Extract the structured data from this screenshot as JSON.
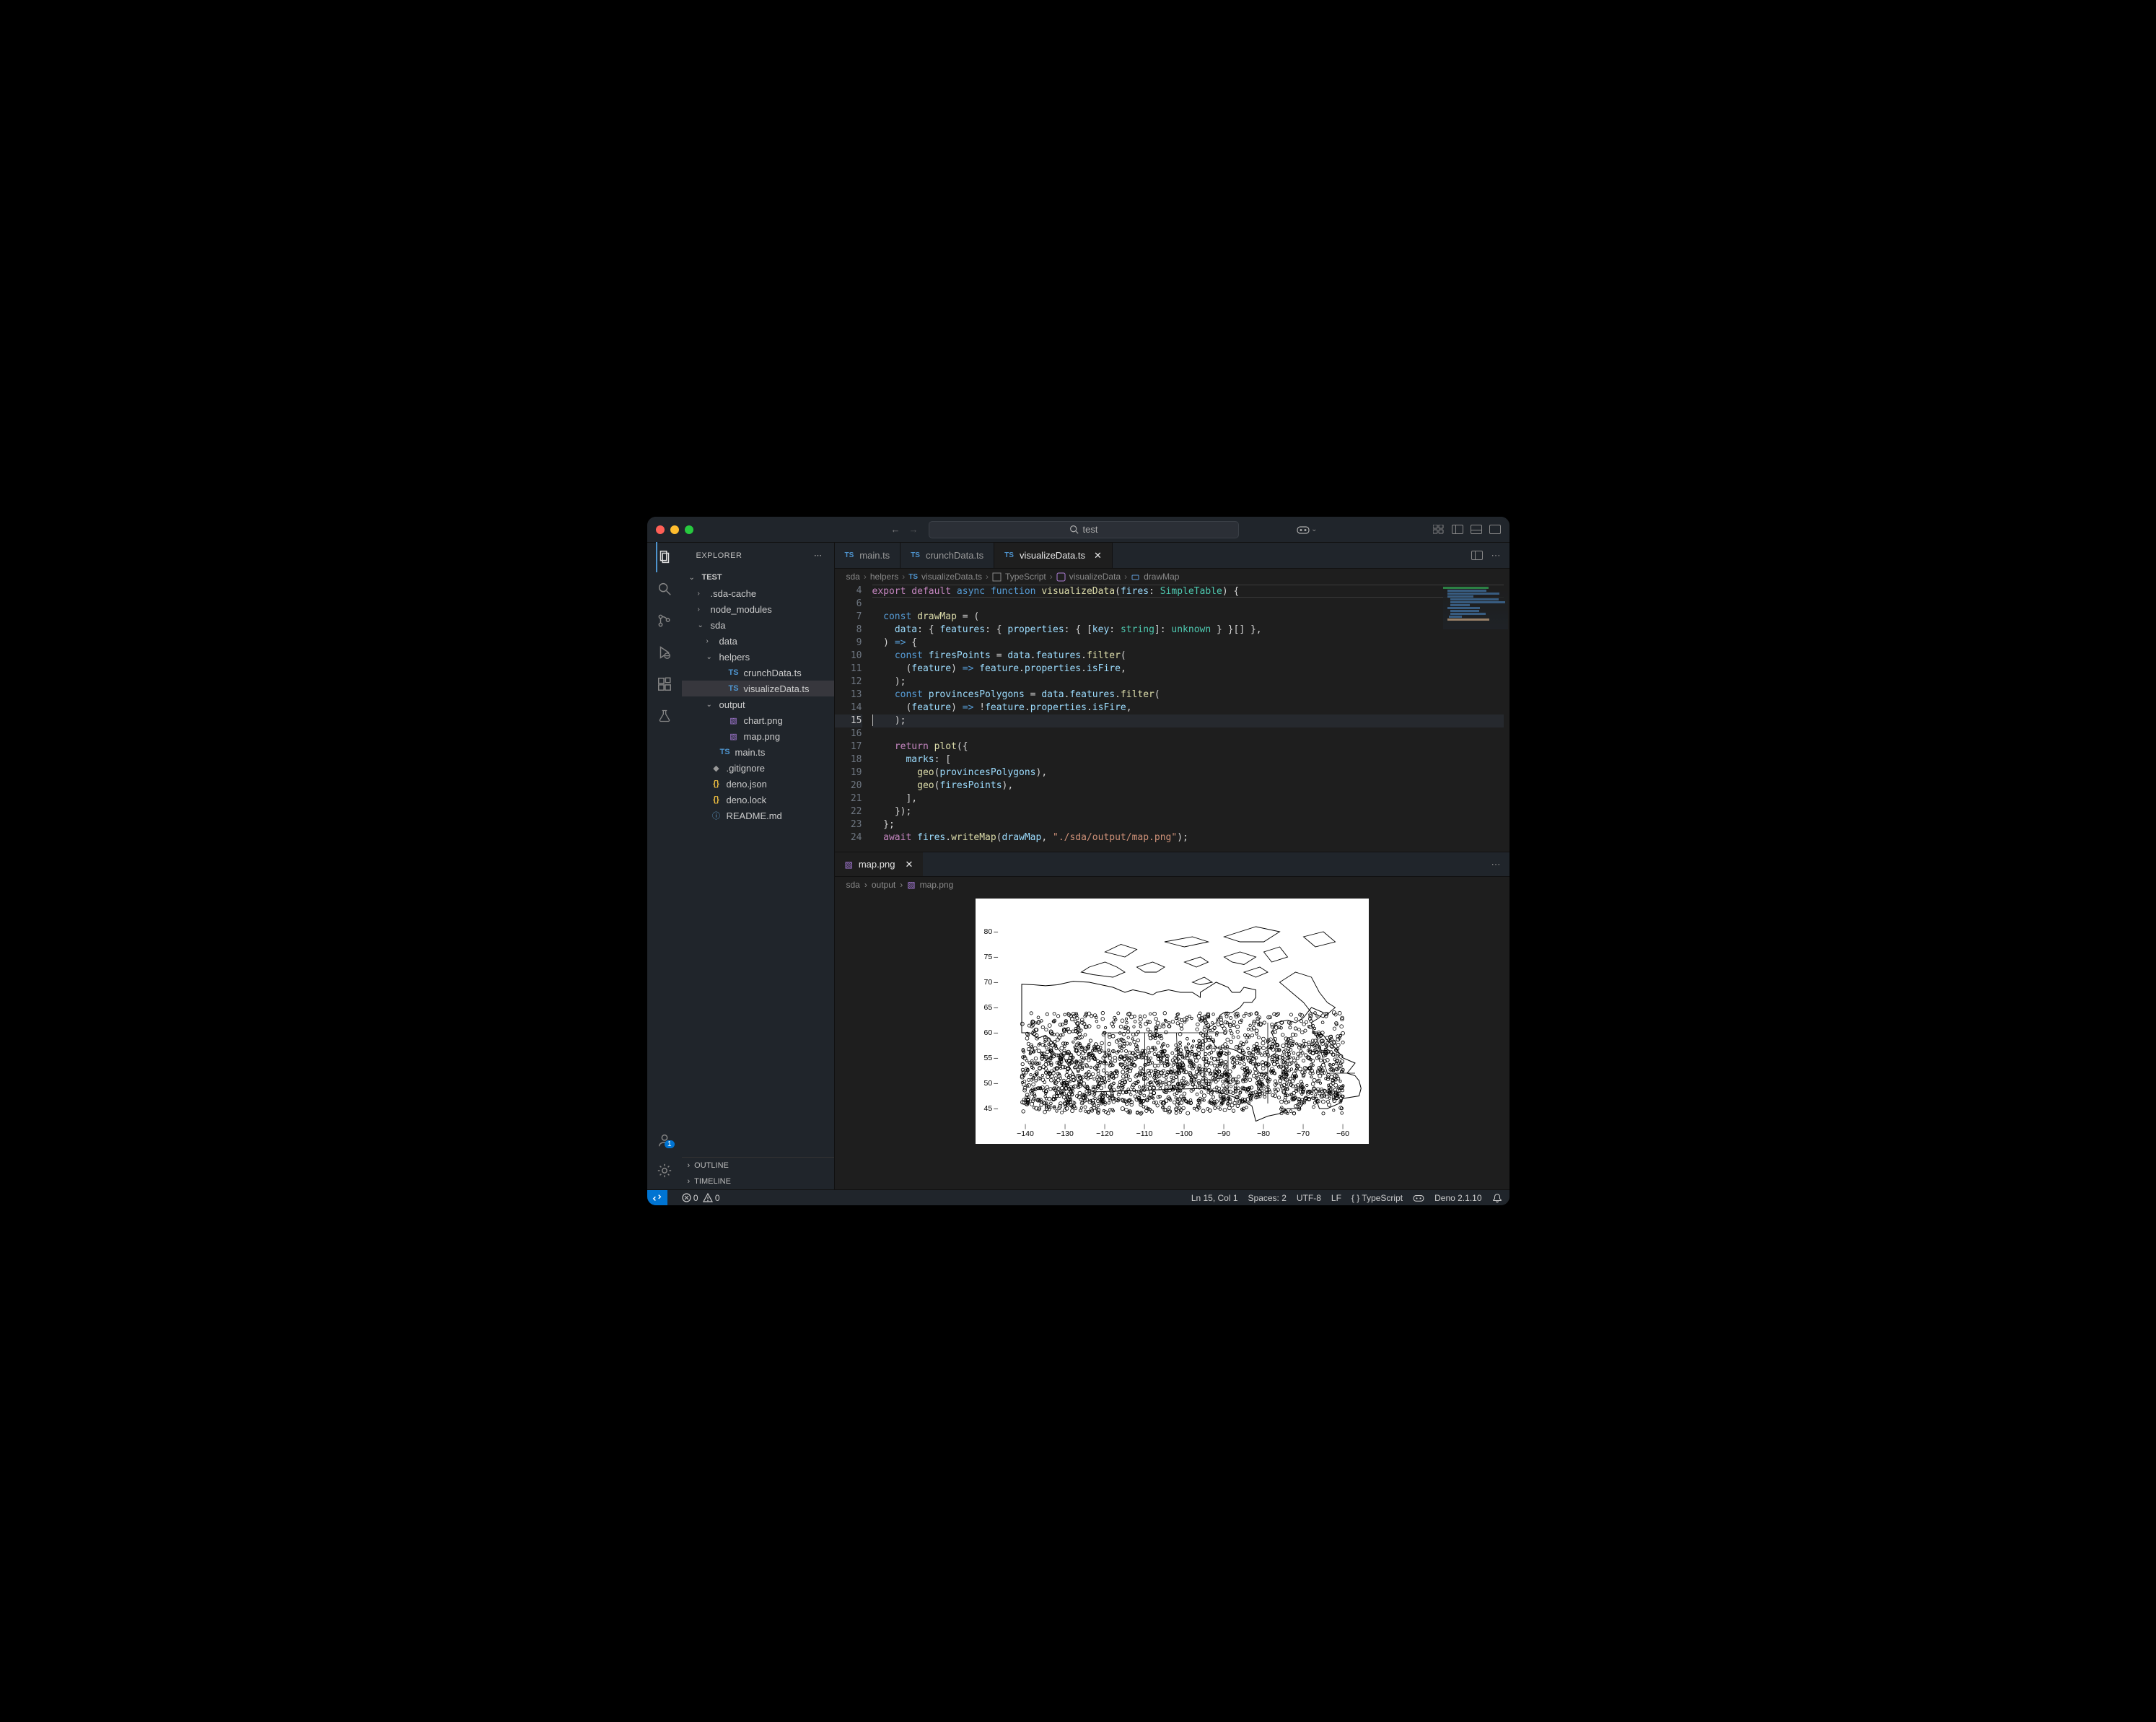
{
  "titlebar": {
    "search_text": "test"
  },
  "sidebar": {
    "title": "EXPLORER",
    "root": "TEST",
    "tree": [
      {
        "kind": "folder",
        "open": false,
        "depth": 1,
        "label": ".sda-cache"
      },
      {
        "kind": "folder",
        "open": false,
        "depth": 1,
        "label": "node_modules"
      },
      {
        "kind": "folder",
        "open": true,
        "depth": 1,
        "label": "sda"
      },
      {
        "kind": "folder",
        "open": false,
        "depth": 2,
        "label": "data"
      },
      {
        "kind": "folder",
        "open": true,
        "depth": 2,
        "label": "helpers"
      },
      {
        "kind": "file",
        "icon": "ts",
        "depth": 3,
        "label": "crunchData.ts"
      },
      {
        "kind": "file",
        "icon": "ts",
        "depth": 3,
        "label": "visualizeData.ts",
        "selected": true
      },
      {
        "kind": "folder",
        "open": true,
        "depth": 2,
        "label": "output"
      },
      {
        "kind": "file",
        "icon": "img",
        "depth": 3,
        "label": "chart.png"
      },
      {
        "kind": "file",
        "icon": "img",
        "depth": 3,
        "label": "map.png"
      },
      {
        "kind": "file",
        "icon": "ts",
        "depth": 2,
        "label": "main.ts"
      },
      {
        "kind": "file",
        "icon": "git",
        "depth": 1,
        "label": ".gitignore"
      },
      {
        "kind": "file",
        "icon": "json",
        "depth": 1,
        "label": "deno.json"
      },
      {
        "kind": "file",
        "icon": "json",
        "depth": 1,
        "label": "deno.lock"
      },
      {
        "kind": "file",
        "icon": "info",
        "depth": 1,
        "label": "README.md"
      }
    ],
    "outline": "OUTLINE",
    "timeline": "TIMELINE"
  },
  "tabs": [
    {
      "icon": "ts",
      "label": "main.ts",
      "active": false,
      "close": false
    },
    {
      "icon": "ts",
      "label": "crunchData.ts",
      "active": false,
      "close": false
    },
    {
      "icon": "ts",
      "label": "visualizeData.ts",
      "active": true,
      "close": true
    }
  ],
  "breadcrumb": {
    "parts": [
      "sda",
      "helpers"
    ],
    "file_icon": "ts",
    "file": "visualizeData.ts",
    "lang": "TypeScript",
    "symbol_icon": "fn",
    "symbol": "visualizeData",
    "subsymbol_icon": "var",
    "subsymbol": "drawMap"
  },
  "editor": {
    "start_line": 4,
    "current_line": 15
  },
  "panel": {
    "tab_label": "map.png",
    "breadcrumb": [
      "sda",
      "output"
    ],
    "file": "map.png"
  },
  "statusbar": {
    "errors": "0",
    "warnings": "0",
    "cursor": "Ln 15, Col 1",
    "spaces": "Spaces: 2",
    "encoding": "UTF-8",
    "eol": "LF",
    "lang": "TypeScript",
    "runtime": "Deno 2.1.10"
  },
  "chart_data": {
    "type": "scatter",
    "title": "",
    "xlabel": "",
    "ylabel": "",
    "xlim": [
      -145,
      -55
    ],
    "ylim": [
      42,
      83
    ],
    "x_ticks": [
      -140,
      -130,
      -120,
      -110,
      -100,
      -90,
      -80,
      -70,
      -60
    ],
    "y_ticks": [
      45,
      50,
      55,
      60,
      65,
      70,
      75,
      80
    ],
    "comment": "Map-style plot; provinces polygons outlines + fire point markers concentrated along southern Canada 45–60°N"
  },
  "accounts_badge": "1"
}
